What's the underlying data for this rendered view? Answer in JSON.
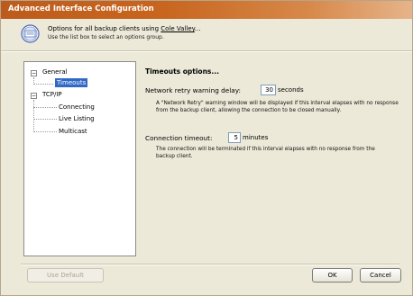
{
  "window": {
    "title": "Advanced Interface Configuration"
  },
  "header": {
    "line1_prefix": "Options for all backup clients using ",
    "line1_link": "Cole Valley",
    "line1_suffix": "...",
    "line2": "Use the list box to select an options group."
  },
  "tree": {
    "items": [
      {
        "label": "General",
        "expanded": true
      },
      {
        "label": "Timeouts",
        "selected": true
      },
      {
        "label": "TCP/IP",
        "expanded": true
      },
      {
        "label": "Connecting"
      },
      {
        "label": "Live Listing"
      },
      {
        "label": "Multicast"
      }
    ]
  },
  "panel": {
    "title": "Timeouts options...",
    "retry": {
      "label": "Network retry warning delay:",
      "value": "30",
      "unit": "seconds",
      "description": "A \"Network Retry\" warning window will be displayed if this interval elapses with no response from the backup client, allowing the connection to be closed manually."
    },
    "timeout": {
      "label": "Connection timeout:",
      "value": "5",
      "unit": "minutes",
      "description": "The connection will be terminated if this interval elapses with no response from the backup client."
    }
  },
  "buttons": {
    "use_default": "Use Default",
    "ok": "OK",
    "cancel": "Cancel"
  },
  "icons": {
    "header": "options-icon"
  },
  "colors": {
    "titlebar": "#c8661f",
    "selection": "#3169c6"
  }
}
